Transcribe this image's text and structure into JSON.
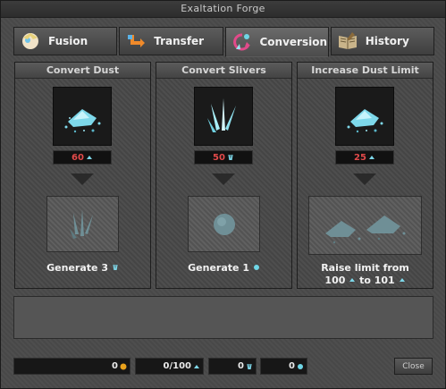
{
  "window": {
    "title": "Exaltation Forge"
  },
  "tabs": [
    {
      "label": "Fusion",
      "icon": "fusion-icon"
    },
    {
      "label": "Transfer",
      "icon": "transfer-icon"
    },
    {
      "label": "Conversion",
      "icon": "conversion-icon",
      "active": true
    },
    {
      "label": "History",
      "icon": "history-book-icon"
    }
  ],
  "panels": [
    {
      "title": "Convert Dust",
      "cost": "60",
      "cost_icon": "dust-mini-icon",
      "result_line1": "Generate 3",
      "result_icon": "sliver-mini-icon"
    },
    {
      "title": "Convert Slivers",
      "cost": "50",
      "cost_icon": "sliver-mini-icon",
      "result_line1": "Generate 1",
      "result_icon": "core-mini-icon"
    },
    {
      "title": "Increase Dust Limit",
      "cost": "25",
      "cost_icon": "dust-mini-icon",
      "result_line1": "Raise limit from",
      "result_from": "100",
      "result_to_word": "to",
      "result_to": "101"
    }
  ],
  "footer": {
    "gold": "0",
    "dust": "0/100",
    "slivers": "0",
    "cores": "0",
    "close_label": "Close"
  },
  "colors": {
    "cost_text": "#e24a4a",
    "crystal": "#6fd6e6",
    "gold": "#e9a21c"
  }
}
